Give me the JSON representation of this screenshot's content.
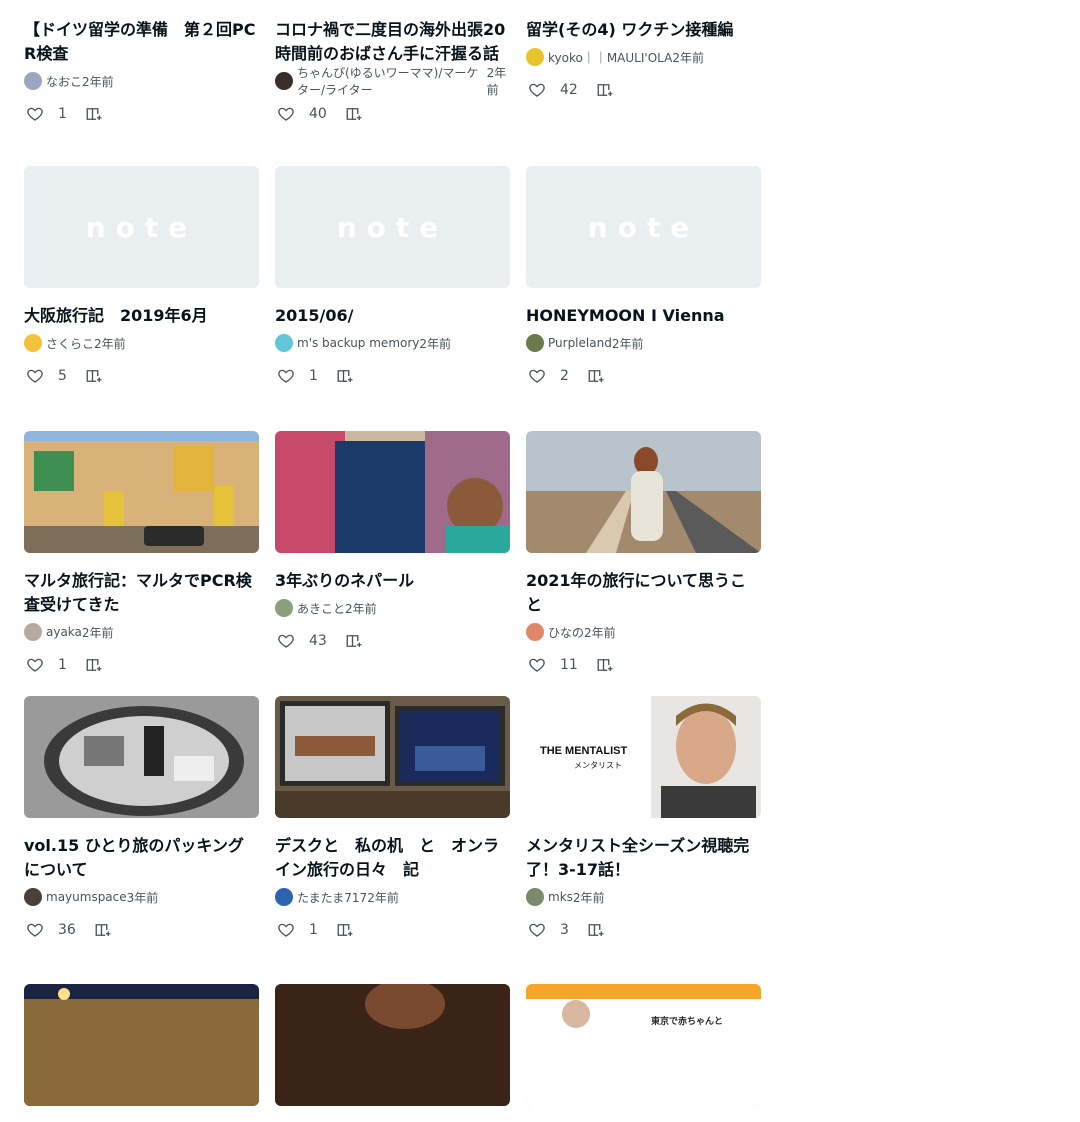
{
  "rows": [
    {
      "cards": [
        {
          "title": "【ドイツ留学の準備　第２回PCR検査",
          "author": "なおこ",
          "time": "2年前",
          "likes": "1",
          "avatar_color": "#9aa7c0",
          "thumb": "none"
        },
        {
          "title": "コロナ禍で二度目の海外出張20時間前のおばさん手に汗握る話",
          "author": "ちゃんぴ(ゆるいワーママ)/マーケター/ライター",
          "time": "2年前",
          "likes": "40",
          "avatar_color": "#3a2e2a",
          "thumb": "none"
        },
        {
          "title": "留学(その4) ワクチン接種編",
          "author": "kyoko｜｜MAULI'OLA",
          "time": "2年前",
          "likes": "42",
          "avatar_color": "#e7c52a",
          "thumb": "none"
        }
      ]
    },
    {
      "cards": [
        {
          "title": "大阪旅行記　2019年6月",
          "author": "さくらこ",
          "time": "2年前",
          "likes": "5",
          "avatar_color": "#f3c33c",
          "thumb": "placeholder"
        },
        {
          "title": "2015/06/",
          "author": "m's backup memory",
          "time": "2年前",
          "likes": "1",
          "avatar_color": "#63c6d8",
          "thumb": "placeholder"
        },
        {
          "title": "HONEYMOON I Vienna",
          "author": "Purpleland",
          "time": "2年前",
          "likes": "2",
          "avatar_color": "#6a7a4a",
          "thumb": "placeholder"
        }
      ]
    },
    {
      "cards": [
        {
          "title": "マルタ旅行記：マルタでPCR検査受けてきた",
          "author": "ayaka",
          "time": "2年前",
          "likes": "1",
          "avatar_color": "#b8a99a",
          "thumb": "malta"
        },
        {
          "title": "3年ぶりのネパール",
          "author": "あきこと",
          "time": "2年前",
          "likes": "43",
          "avatar_color": "#8aa07a",
          "thumb": "nepal"
        },
        {
          "title": "2021年の旅行について思うこと",
          "author": "ひなの",
          "time": "2年前",
          "likes": "11",
          "avatar_color": "#e0876a",
          "thumb": "road"
        }
      ]
    },
    {
      "cards": [
        {
          "title": "vol.15 ひとり旅のパッキングについて",
          "author": "mayumspace",
          "time": "3年前",
          "likes": "36",
          "avatar_color": "#4a4038",
          "thumb": "packing"
        },
        {
          "title": "デスクと　私の机　と　オンライン旅行の日々　記",
          "author": "たまたま717",
          "time": "2年前",
          "likes": "1",
          "avatar_color": "#2d63b0",
          "thumb": "desk"
        },
        {
          "title": "メンタリスト全シーズン視聴完了！3-17話！",
          "author": "mks",
          "time": "2年前",
          "likes": "3",
          "avatar_color": "#7a8a6a",
          "thumb": "mentalist",
          "thumb_text": "THE MENTALIST",
          "thumb_sub": "メンタリスト"
        }
      ]
    },
    {
      "cards": [
        {
          "title": "",
          "author": "",
          "time": "",
          "likes": "",
          "avatar_color": "#000",
          "thumb": "colosseum"
        },
        {
          "title": "",
          "author": "",
          "time": "",
          "likes": "",
          "avatar_color": "#000",
          "thumb": "dark"
        },
        {
          "title": "",
          "author": "",
          "time": "",
          "likes": "",
          "avatar_color": "#000",
          "thumb": "baby",
          "thumb_text": "東京で赤ちゃんと"
        }
      ]
    }
  ],
  "placeholder_logo": "note",
  "icons": {
    "like": "heart-icon",
    "magazine": "add-to-magazine-icon"
  }
}
